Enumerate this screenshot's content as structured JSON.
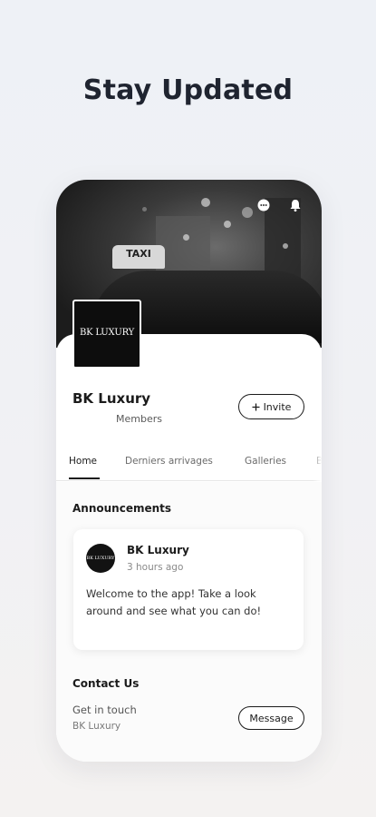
{
  "headline": "Stay Updated",
  "cover": {
    "taxi_sign": "TAXI",
    "icons": [
      "chat-icon",
      "bell-icon"
    ]
  },
  "group": {
    "logo_text": "BK LUXURY",
    "name": "BK Luxury",
    "members_label": "Members",
    "invite_label": "Invite"
  },
  "tabs": [
    {
      "label": "Home",
      "active": true
    },
    {
      "label": "Derniers arrivages",
      "active": false
    },
    {
      "label": "Galleries",
      "active": false
    },
    {
      "label": "B",
      "active": false
    }
  ],
  "announcements": {
    "title": "Announcements",
    "post": {
      "author": "BK Luxury",
      "time": "3 hours ago",
      "body": "Welcome to the app! Take a look around and see what you can do!"
    }
  },
  "contact": {
    "title": "Contact Us",
    "line1": "Get in touch",
    "line2": "BK Luxury",
    "message_label": "Message"
  },
  "colors": {
    "accent": "#1b1b1b",
    "background": "#f1f2f5"
  }
}
